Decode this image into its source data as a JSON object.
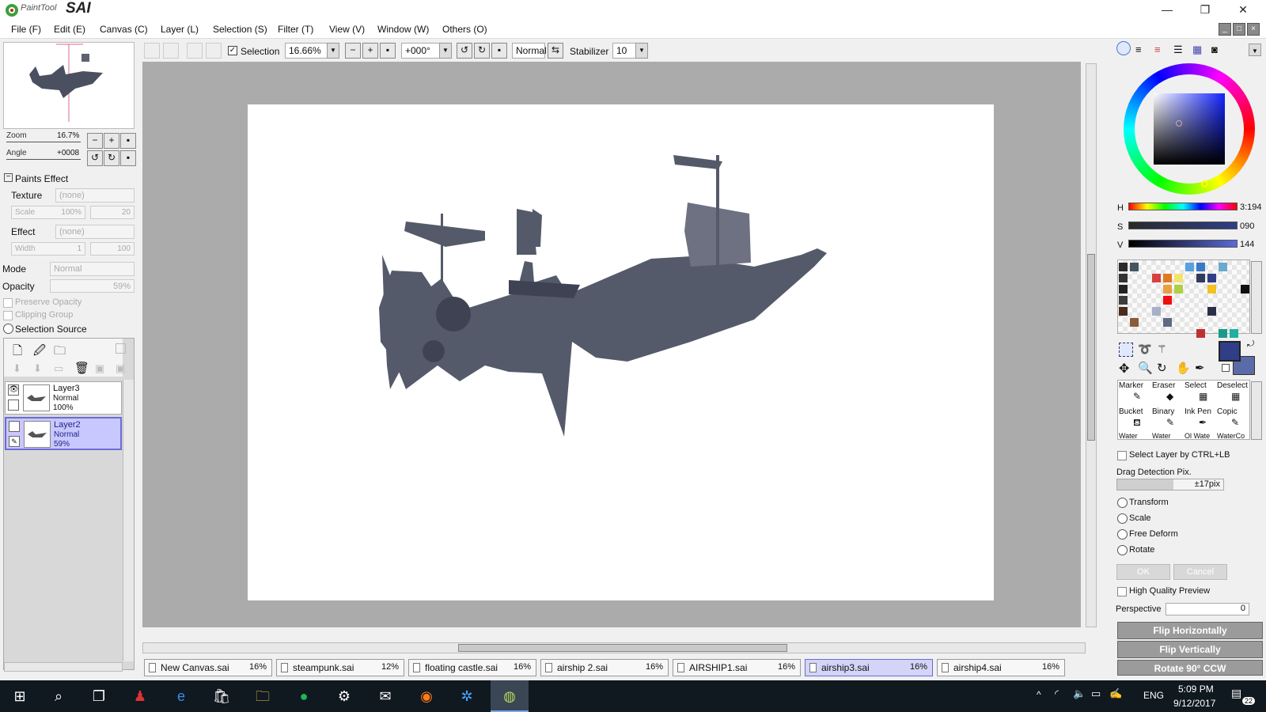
{
  "window": {
    "title_small": "PaintTool",
    "title_big": "SAI",
    "minimize": "—",
    "restore": "❐",
    "close": "✕"
  },
  "menu": [
    "File (F)",
    "Edit (E)",
    "Canvas (C)",
    "Layer (L)",
    "Selection (S)",
    "Filter (T)",
    "View (V)",
    "Window (W)",
    "Others (O)"
  ],
  "toolbar": {
    "selection_label": "Selection",
    "zoom": "16.66%",
    "angle": "+000°",
    "blend": "Normal",
    "stabilizer_label": "Stabilizer",
    "stabilizer_value": "10"
  },
  "left": {
    "zoom_label": "Zoom",
    "zoom_value": "16.7%",
    "angle_label": "Angle",
    "angle_value": "+0008",
    "paints_effect": "Paints Effect",
    "texture_label": "Texture",
    "texture_value": "(none)",
    "scale_label": "Scale",
    "scale_value": "100%",
    "scale_num": "20",
    "effect_label": "Effect",
    "effect_value": "(none)",
    "width_label": "Width",
    "width_value": "1",
    "width_num": "100",
    "mode_label": "Mode",
    "mode_value": "Normal",
    "opacity_label": "Opacity",
    "opacity_value": "59%",
    "preserve_opacity": "Preserve Opacity",
    "clipping_group": "Clipping Group",
    "selection_source": "Selection Source",
    "layers": [
      {
        "name": "Layer3",
        "mode": "Normal",
        "opacity": "100%"
      },
      {
        "name": "Layer2",
        "mode": "Normal",
        "opacity": "59%"
      }
    ]
  },
  "tabs": [
    {
      "name": "New Canvas.sai",
      "pct": "16%"
    },
    {
      "name": "steampunk.sai",
      "pct": "12%"
    },
    {
      "name": "floating castle.sai",
      "pct": "16%"
    },
    {
      "name": "airship 2.sai",
      "pct": "16%"
    },
    {
      "name": "AIRSHIP1.sai",
      "pct": "16%"
    },
    {
      "name": "airship3.sai",
      "pct": "16%"
    },
    {
      "name": "airship4.sai",
      "pct": "16%"
    }
  ],
  "right": {
    "h_label": "H",
    "h_value": "3:194",
    "s_label": "S",
    "s_value": "090",
    "v_label": "V",
    "v_value": "144",
    "tools": [
      "Marker",
      "Eraser",
      "Select",
      "Deselect",
      "Bucket",
      "Binary",
      "Ink Pen",
      "Copic",
      "Water",
      "Water",
      "Ol Wate",
      "WaterCo"
    ],
    "select_layer_ctrl": "Select Layer by CTRL+LB",
    "drag_detection_label": "Drag Detection Pix.",
    "drag_detection_value": "±17pix",
    "transform": "Transform",
    "scale": "Scale",
    "free_deform": "Free Deform",
    "rotate": "Rotate",
    "ok": "OK",
    "cancel": "Cancel",
    "hq_preview": "High Quality Preview",
    "perspective_label": "Perspective",
    "perspective_value": "0",
    "flip_h": "Flip Horizontally",
    "flip_v": "Flip Vertically",
    "rotate_ccw": "Rotate 90° CCW",
    "fg_color": "#2f3e86",
    "bg_color": "#5a6ba8"
  },
  "taskbar": {
    "lang": "ENG",
    "time": "5:09 PM",
    "date": "9/12/2017",
    "notif_count": "22"
  }
}
